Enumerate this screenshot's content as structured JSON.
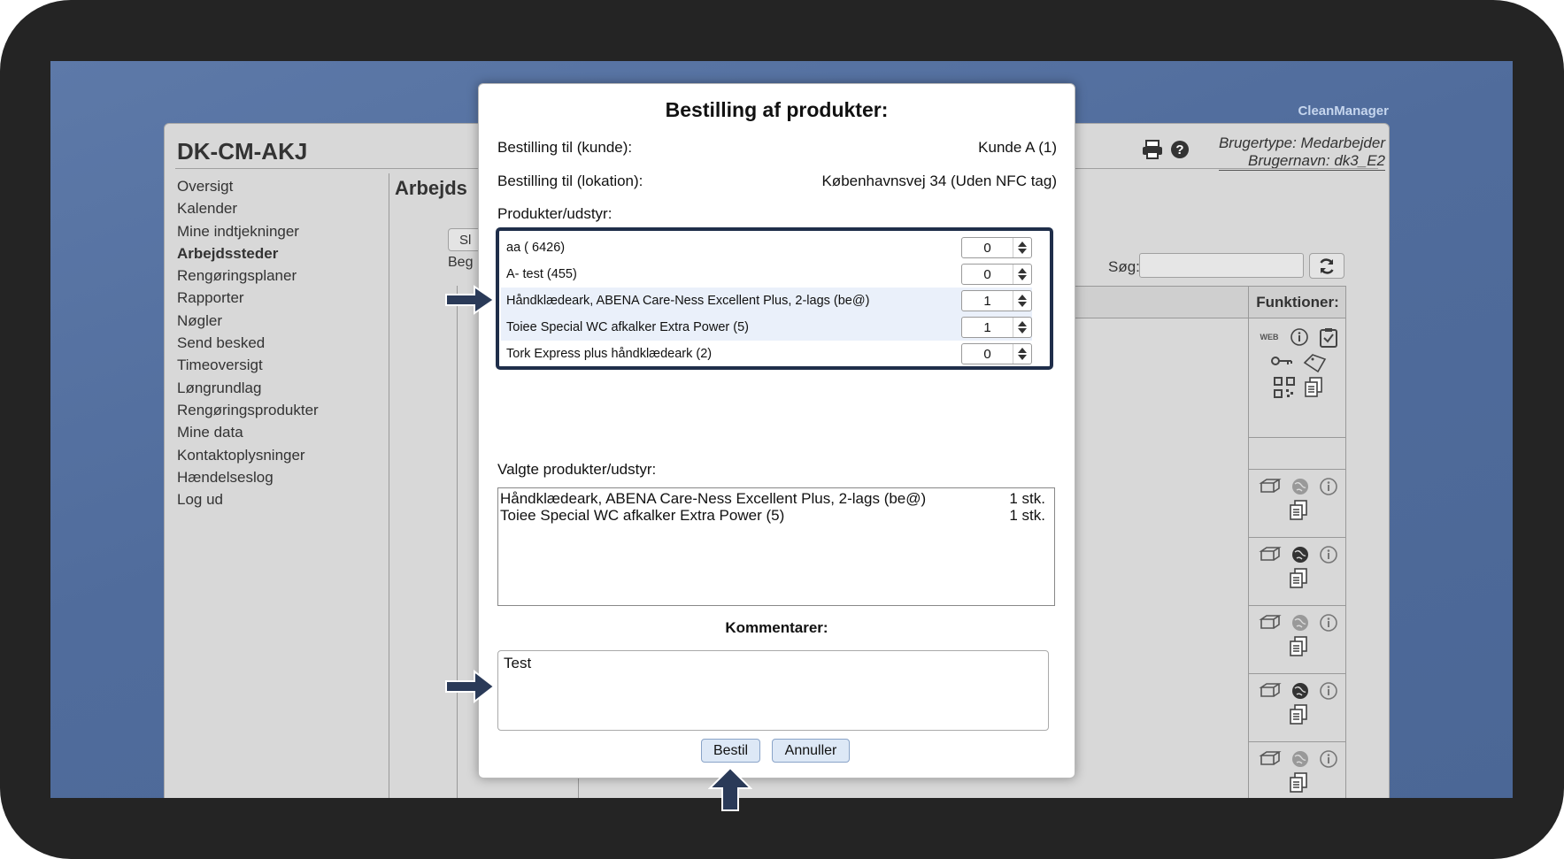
{
  "app": {
    "brand": "CleanManager",
    "site_code": "DK-CM-AKJ",
    "user_type": "Brugertype: Medarbejder",
    "user_name": "Brugernavn: dk3_E2"
  },
  "nav": {
    "items": [
      {
        "label": "Oversigt",
        "active": false
      },
      {
        "label": "Kalender",
        "active": false
      },
      {
        "label": "Mine indtjekninger",
        "active": false
      },
      {
        "label": "Arbejdssteder",
        "active": true
      },
      {
        "label": "Rengøringsplaner",
        "active": false
      },
      {
        "label": "Rapporter",
        "active": false
      },
      {
        "label": "Nøgler",
        "active": false
      },
      {
        "label": "Send besked",
        "active": false
      },
      {
        "label": "Timeoversigt",
        "active": false
      },
      {
        "label": "Løngrundlag",
        "active": false
      },
      {
        "label": "Rengøringsprodukter",
        "active": false
      },
      {
        "label": "Mine data",
        "active": false
      },
      {
        "label": "Kontaktoplysninger",
        "active": false
      },
      {
        "label": "Hændelseslog",
        "active": false
      },
      {
        "label": "Log ud",
        "active": false
      }
    ]
  },
  "background": {
    "section_title_fragment": "Arbejds",
    "button_fragment": "Sl",
    "text_fragment": "Beg",
    "search_label": "Søg:",
    "functions_header": "Funktioner:"
  },
  "modal": {
    "title": "Bestilling af produkter:",
    "customer_label": "Bestilling til (kunde):",
    "customer_value": "Kunde A (1)",
    "location_label": "Bestilling til (lokation):",
    "location_value": "Københavnsvej 34 (Uden NFC tag)",
    "products_label": "Produkter/udstyr:",
    "products": [
      {
        "name": "aa ( 6426)",
        "qty": "0"
      },
      {
        "name": "A- test (455)",
        "qty": "0"
      },
      {
        "name": "Håndklædeark, ABENA Care-Ness Excellent Plus, 2-lags (be@)",
        "qty": "1"
      },
      {
        "name": "Toiee Special WC afkalker Extra Power (5)",
        "qty": "1"
      },
      {
        "name": "Tork Express plus håndklædeark (2)",
        "qty": "0"
      }
    ],
    "selected_label": "Valgte produkter/udstyr:",
    "selected": [
      {
        "name": "Håndklædeark, ABENA Care-Ness Excellent Plus, 2-lags (be@)",
        "qty": "1 stk."
      },
      {
        "name": "Toiee Special WC afkalker Extra Power (5)",
        "qty": "1 stk."
      }
    ],
    "comments_label": "Kommentarer:",
    "comments_value": "Test",
    "order_button": "Bestil",
    "cancel_button": "Annuller"
  },
  "colors": {
    "arrow": "#2a3a58",
    "frame": "#242424",
    "desktop": "#5672a2"
  }
}
